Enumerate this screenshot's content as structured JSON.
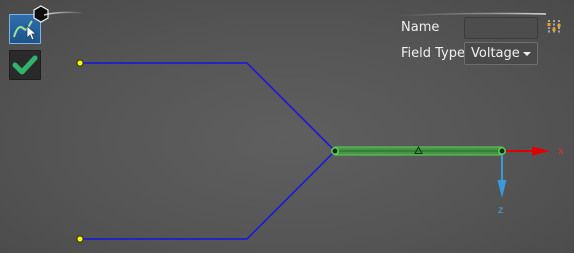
{
  "toolbar": {
    "sketch_tool_icon": "sketch-select-icon",
    "finish_tool_icon": "checkmark-icon",
    "badge_icon": "hexagon-icon"
  },
  "properties": {
    "name_label": "Name",
    "name_value": "",
    "field_type_label": "Field Type",
    "field_type_value": "Voltage",
    "options_icon": "options-icon"
  },
  "triad": {
    "x_label": "x",
    "z_label": "z"
  },
  "colors": {
    "background": "#575757",
    "wire": "#1414e6",
    "selected_segment": "#3ac23a",
    "endpoint": "#ffff00",
    "x_axis": "#e00000",
    "z_axis": "#3a9ad9",
    "tool_active": "#2a64a6"
  }
}
